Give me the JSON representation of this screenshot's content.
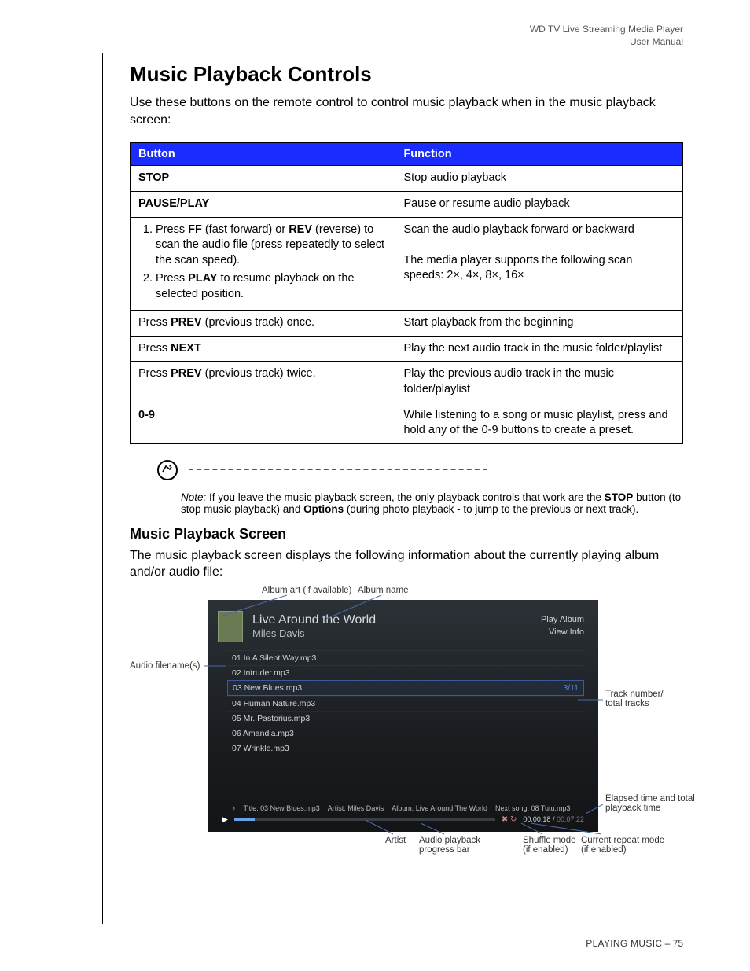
{
  "header": {
    "l1": "WD TV Live Streaming Media Player",
    "l2": "User Manual"
  },
  "h1": "Music Playback Controls",
  "intro": "Use these buttons on the remote control to control music playback when in the music playback screen:",
  "table": {
    "head": [
      "Button",
      "Function"
    ],
    "rows": [
      {
        "b": [
          "STOP"
        ],
        "f": [
          "Stop audio playback"
        ]
      },
      {
        "b": [
          "PAUSE/PLAY"
        ],
        "f": [
          "Pause or resume audio playback"
        ]
      },
      {
        "b_list": [
          [
            "Press ",
            "FF",
            " (fast forward) or ",
            "REV",
            " (reverse) to scan the audio file (press repeatedly to select the scan speed)."
          ],
          [
            "Press ",
            "PLAY",
            " to resume playback on the selected position."
          ]
        ],
        "f": [
          "Scan the audio playback forward or backward",
          "",
          "The media player supports the following scan speeds: 2×, 4×, 8×, 16×"
        ]
      },
      {
        "b_mixed": [
          "Press ",
          "PREV",
          " (previous track) once."
        ],
        "f": [
          "Start playback from the beginning"
        ]
      },
      {
        "b_mixed": [
          "Press ",
          "NEXT"
        ],
        "f": [
          "Play the next audio track in the music folder/playlist"
        ]
      },
      {
        "b_mixed": [
          "Press ",
          "PREV",
          " (previous track) twice."
        ],
        "f": [
          "Play the previous audio track in the music folder/playlist"
        ]
      },
      {
        "b": [
          "0-9"
        ],
        "f": [
          "While listening to a song or music playlist, press and hold any of the 0-9 buttons to create a preset."
        ]
      }
    ]
  },
  "note": {
    "lead": "Note:",
    "parts": [
      " If you leave the music playback screen, the only playback controls that work are the ",
      "STOP",
      " button (to stop music playback) and ",
      "Options",
      " (during photo playback - to jump to the previous or next track)."
    ]
  },
  "h2": "Music Playback Screen",
  "para2": "The music playback screen displays the following information about the currently playing album and/or audio file:",
  "labels": {
    "album_art": "Album art (if available)",
    "album_name": "Album name",
    "audio_filenames": "Audio filename(s)",
    "track_number": "Track number/\ntotal tracks",
    "elapsed": "Elapsed time and total playback time",
    "artist": "Artist",
    "progress": "Audio playback\nprogress bar",
    "shuffle": "Shuffle mode\n(if enabled)",
    "repeat": "Current repeat mode\n(if enabled)"
  },
  "shot": {
    "title": "Live Around the World",
    "artist": "Miles Davis",
    "right1": "Play Album",
    "right2": "View Info",
    "tracks": [
      "01 In A Silent Way.mp3",
      "02 Intruder.mp3",
      "03 New Blues.mp3",
      "04 Human Nature.mp3",
      "05 Mr. Pastorius.mp3",
      "06 Amandla.mp3",
      "07 Wrinkle.mp3"
    ],
    "selected_index": 2,
    "track_counter": "3/11",
    "meta_title": "Title: 03 New Blues.mp3",
    "meta_artist": "Artist: Miles Davis",
    "meta_album": "Album: Live Around The World",
    "meta_next": "Next song: 08 Tutu.mp3",
    "elapsed": "00:00:18",
    "total": "00:07:22"
  },
  "footer": {
    "section": "PLAYING MUSIC",
    "sep": " – ",
    "page": "75"
  }
}
